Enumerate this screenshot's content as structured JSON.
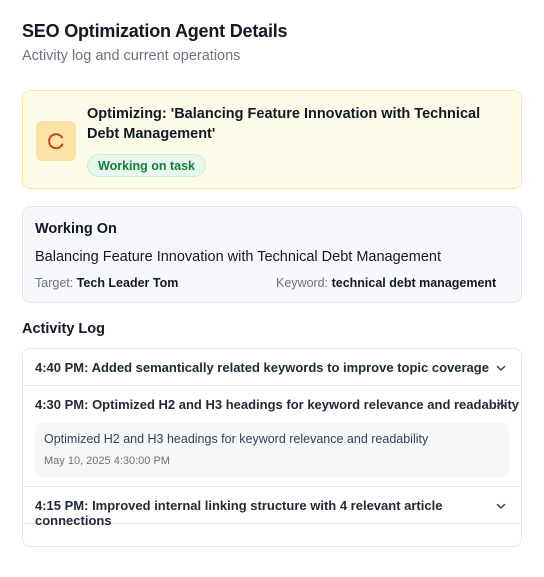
{
  "header": {
    "title": "SEO Optimization Agent Details",
    "subtitle": "Activity log and current operations"
  },
  "status": {
    "text": "Optimizing: 'Balancing Feature Innovation with Technical Debt Management'",
    "badge": "Working on task",
    "icon": "loading-spinner-icon",
    "accent_color": "#c2410c",
    "card_color": "#fefbe8"
  },
  "working_on": {
    "heading": "Working On",
    "article": "Balancing Feature Innovation with Technical Debt Management",
    "target_label": "Target:",
    "target_value": "Tech Leader Tom",
    "keyword_label": "Keyword:",
    "keyword_value": "technical debt management"
  },
  "activity_log": {
    "heading": "Activity Log",
    "entries": [
      {
        "label": "4:40 PM: Added semantically related keywords to improve topic coverage",
        "expanded": false
      },
      {
        "label": "4:30 PM: Optimized H2 and H3 headings for keyword relevance and readability",
        "expanded": true,
        "detail": "Optimized H2 and H3 headings for keyword relevance and readability",
        "timestamp": "May 10, 2025 4:30:00 PM"
      },
      {
        "label": "4:15 PM: Improved internal linking structure with 4 relevant article connections",
        "expanded": false
      }
    ]
  }
}
